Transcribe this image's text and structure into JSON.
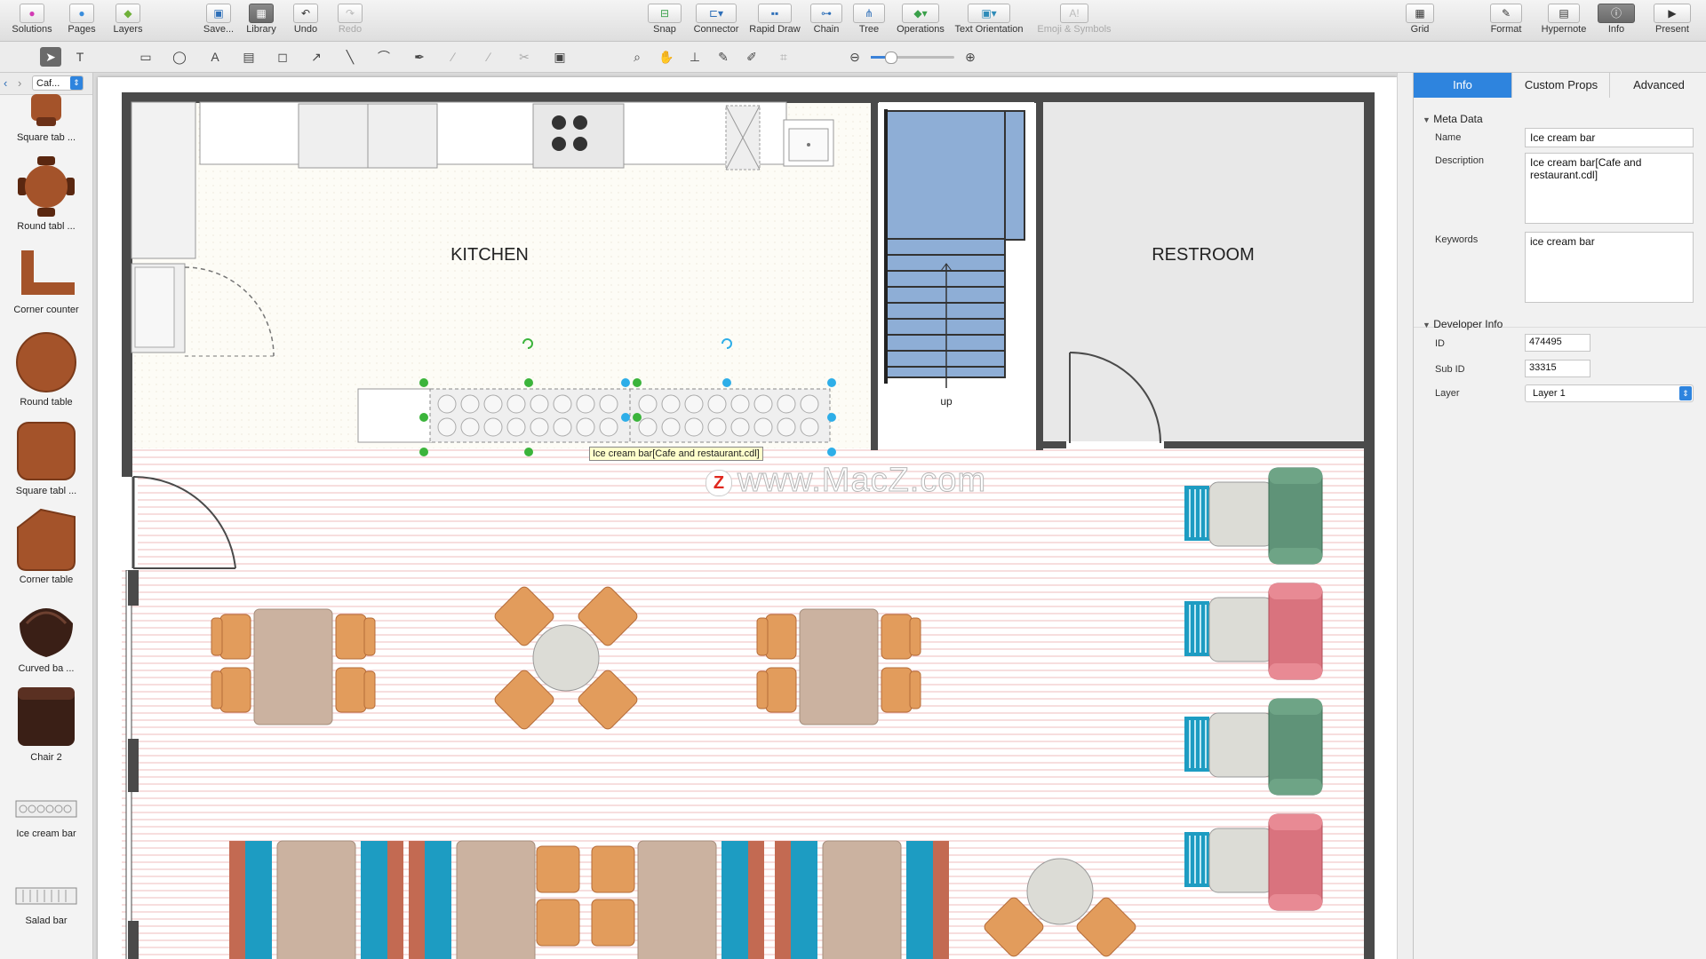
{
  "topbar": {
    "solutions": "Solutions",
    "pages": "Pages",
    "layers": "Layers",
    "save": "Save...",
    "library": "Library",
    "undo": "Undo",
    "redo": "Redo",
    "snap": "Snap",
    "connector": "Connector",
    "rapid_draw": "Rapid Draw",
    "chain": "Chain",
    "tree": "Tree",
    "operations": "Operations",
    "text_orientation": "Text Orientation",
    "emoji": "Emoji & Symbols",
    "grid": "Grid",
    "format": "Format",
    "hypernote": "Hypernote",
    "info": "Info",
    "present": "Present"
  },
  "library": {
    "selector": "Caf...",
    "items": [
      {
        "label": "Square tab ..."
      },
      {
        "label": "Round tabl ..."
      },
      {
        "label": "Corner counter"
      },
      {
        "label": "Round table"
      },
      {
        "label": "Square tabl ..."
      },
      {
        "label": "Corner table"
      },
      {
        "label": "Curved ba ..."
      },
      {
        "label": "Chair 2"
      },
      {
        "label": "Ice cream bar"
      },
      {
        "label": "Salad bar"
      }
    ]
  },
  "canvas": {
    "kitchen_label": "KITCHEN",
    "restroom_label": "RESTROOM",
    "stairs_label": "up",
    "tooltip": "Ice cream bar[Cafe and restaurant.cdl]",
    "watermark": "www.MacZ.com",
    "watermark_badge": "Z"
  },
  "inspector": {
    "tabs": [
      "Info",
      "Custom Props",
      "Advanced"
    ],
    "meta_title": "Meta Data",
    "name_label": "Name",
    "name_value": "Ice cream bar",
    "description_label": "Description",
    "description_value": "Ice cream bar[Cafe and restaurant.cdl]",
    "keywords_label": "Keywords",
    "keywords_value": "ice cream bar",
    "dev_title": "Developer Info",
    "id_label": "ID",
    "id_value": "474495",
    "subid_label": "Sub ID",
    "subid_value": "33315",
    "layer_label": "Layer",
    "layer_value": "Layer 1"
  },
  "colors": {
    "accent": "#2e84de",
    "chair_orange": "#e29c5c",
    "table_tan": "#cbb2a0",
    "stair_blue": "#8eaed6",
    "teal": "#1d9cc2",
    "sofa_green": "#5f9378",
    "sofa_pink": "#d9737e",
    "wall": "#4a4a4a"
  }
}
